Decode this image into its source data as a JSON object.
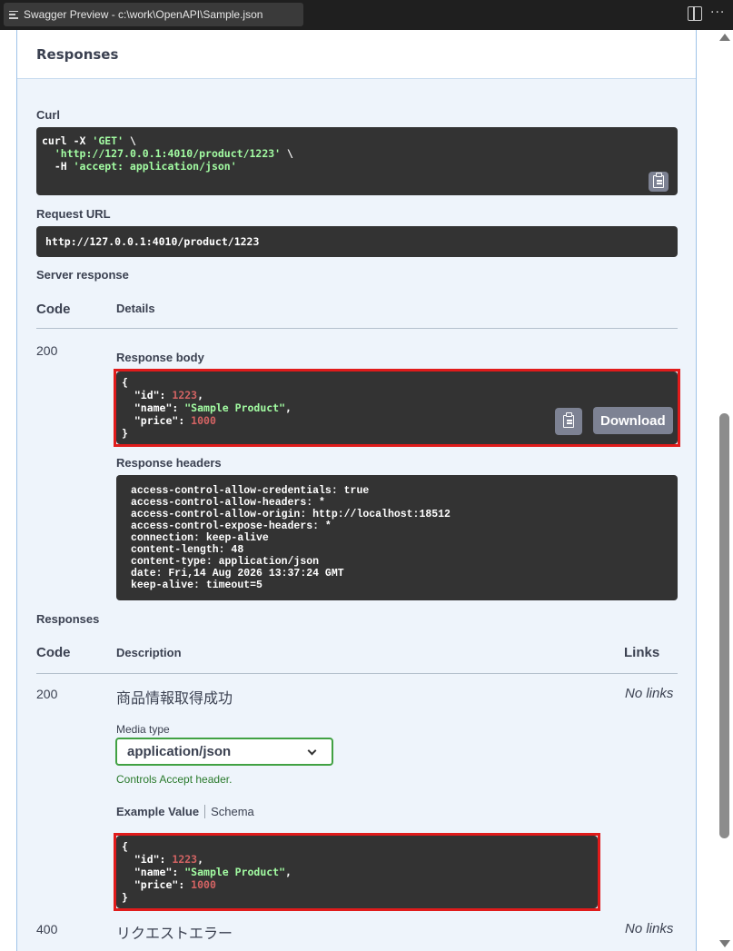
{
  "window": {
    "tab_title": "Swagger Preview - c:\\work\\OpenAPI\\Sample.json",
    "more": "···"
  },
  "panel": {
    "title": "Responses"
  },
  "curl": {
    "label": "Curl",
    "line1_cmd": "curl -X ",
    "line1_method": "'GET'",
    "line1_end": " \\",
    "line2_indent": "  ",
    "line2_url": "'http://127.0.0.1:4010/product/1223'",
    "line2_end": " \\",
    "line3_flag": "  -H ",
    "line3_header": "'accept: application/json'"
  },
  "request_url": {
    "label": "Request URL",
    "value": "http://127.0.0.1:4010/product/1223"
  },
  "server_response": {
    "label": "Server response",
    "col_code": "Code",
    "col_details": "Details",
    "code": "200",
    "body_label": "Response body",
    "body": {
      "open": "{",
      "id_key": "  \"id\"",
      "id_val": "1223",
      "name_key": "  \"name\"",
      "name_val": "\"Sample Product\"",
      "price_key": "  \"price\"",
      "price_val": "1000",
      "close": "}"
    },
    "download_label": "Download",
    "headers_label": "Response headers",
    "headers": "access-control-allow-credentials: true\naccess-control-allow-headers: *\naccess-control-allow-origin: http://localhost:18512\naccess-control-expose-headers: *\nconnection: keep-alive\ncontent-length: 48\ncontent-type: application/json\ndate: Fri,14 Aug 2026 13:37:24 GMT\nkeep-alive: timeout=5"
  },
  "responses": {
    "label": "Responses",
    "col_code": "Code",
    "col_description": "Description",
    "col_links": "Links",
    "rows": [
      {
        "code": "200",
        "description": "商品情報取得成功",
        "links": "No links"
      },
      {
        "code": "400",
        "description": "リクエストエラー",
        "links": "No links"
      }
    ],
    "media_type_label": "Media type",
    "media_type_value": "application/json",
    "accept_note": "Controls Accept header.",
    "tab_example": "Example Value",
    "tab_schema": "Schema",
    "example": {
      "open": "{",
      "id_key": "  \"id\"",
      "id_val": "1223",
      "name_key": "  \"name\"",
      "name_val": "\"Sample Product\"",
      "price_key": "  \"price\"",
      "price_val": "1000",
      "close": "}"
    }
  },
  "colors": {
    "highlight": "#e01b1b",
    "select_border": "#41a143",
    "code_bg": "#333333"
  }
}
